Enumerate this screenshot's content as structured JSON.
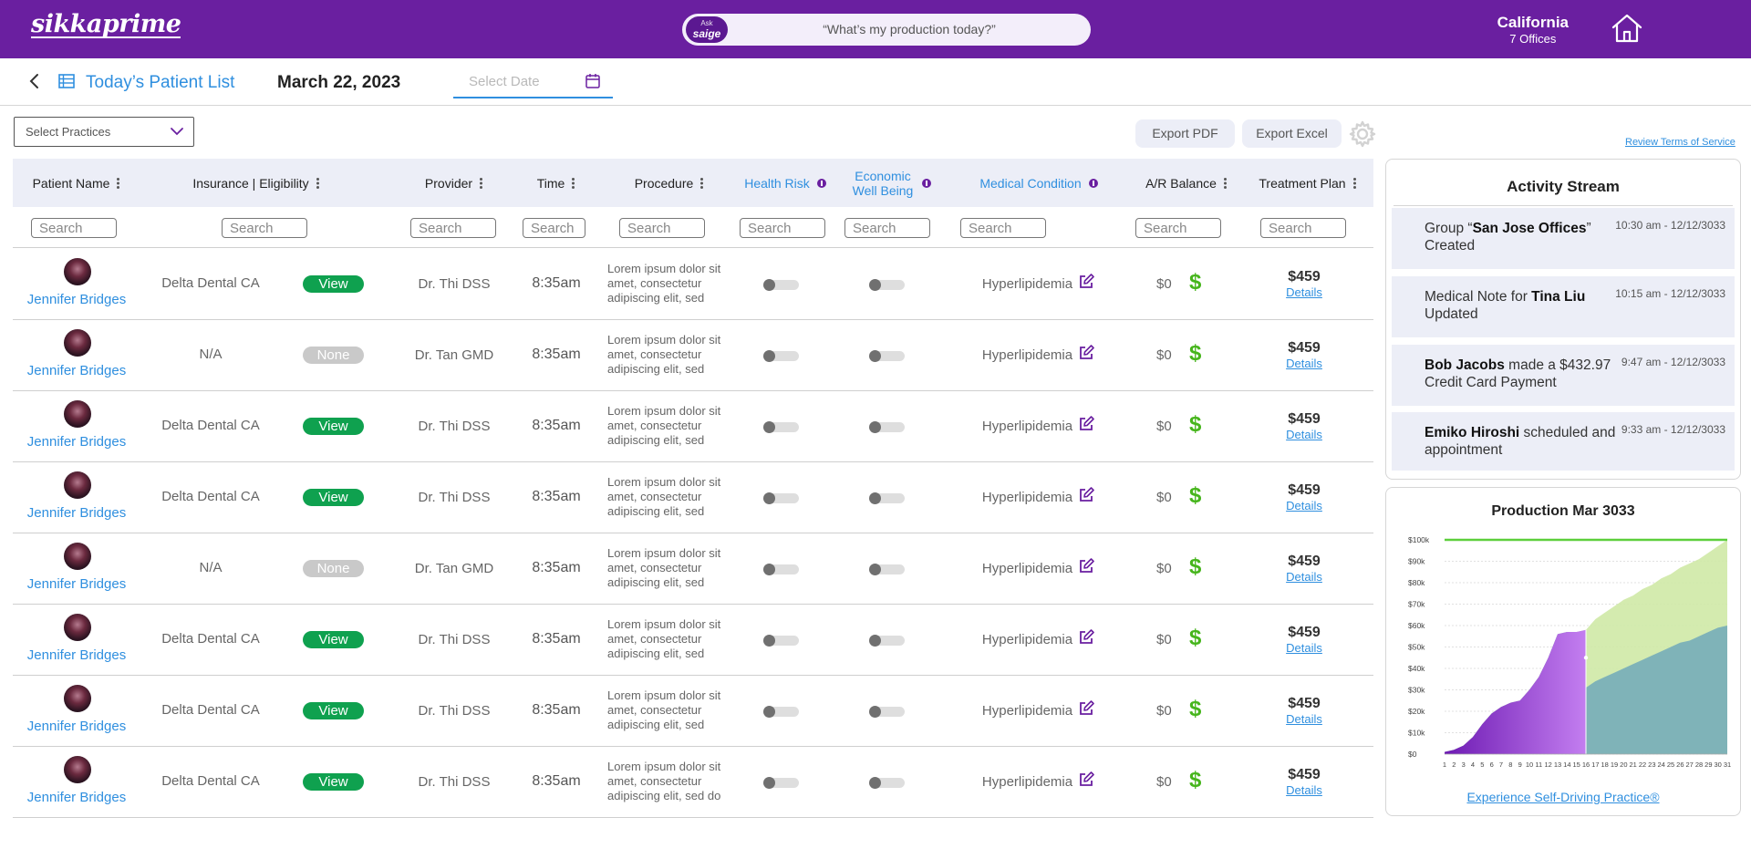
{
  "header": {
    "logo_text": "sikkaprime",
    "ask_badge_top": "Ask",
    "ask_badge_bottom": "saige",
    "ask_prompt": "“What’s my production today?”",
    "location_state": "California",
    "location_offices": "7 Offices"
  },
  "subheader": {
    "title": "Today’s Patient List",
    "date": "March 22, 2023",
    "date_placeholder": "Select Date"
  },
  "toolbar": {
    "practices_placeholder": "Select Practices",
    "export_pdf": "Export PDF",
    "export_excel": "Export Excel",
    "terms_link": "Review Terms of Service"
  },
  "table": {
    "columns": [
      {
        "label": "Patient Name",
        "menu": true,
        "info": false,
        "highlight": false
      },
      {
        "label": "Insurance | Eligibility",
        "menu": true,
        "info": false,
        "highlight": false
      },
      {
        "label": "Provider",
        "menu": true,
        "info": false,
        "highlight": false
      },
      {
        "label": "Time",
        "menu": true,
        "info": false,
        "highlight": false
      },
      {
        "label": "Procedure",
        "menu": true,
        "info": false,
        "highlight": false
      },
      {
        "label": "Health Risk",
        "menu": false,
        "info": true,
        "highlight": true
      },
      {
        "label": "Economic Well Being",
        "menu": false,
        "info": true,
        "highlight": true
      },
      {
        "label": "Medical Condition",
        "menu": false,
        "info": true,
        "highlight": true
      },
      {
        "label": "A/R Balance",
        "menu": true,
        "info": false,
        "highlight": false
      },
      {
        "label": "Treatment Plan",
        "menu": true,
        "info": false,
        "highlight": false
      }
    ],
    "search_placeholder": "Search",
    "rows": [
      {
        "name": "Jennifer Bridges",
        "insurance": "Delta Dental CA",
        "eligibility": "View",
        "provider": "Dr. Thi DSS",
        "time": "8:35am",
        "procedure": "Lorem ipsum dolor sit amet, consectetur adipiscing elit, sed",
        "condition": "Hyperlipidemia",
        "balance": "$0",
        "plan_amount": "$459",
        "plan_link": "Details"
      },
      {
        "name": "Jennifer Bridges",
        "insurance": "N/A",
        "eligibility": "None",
        "provider": "Dr. Tan GMD",
        "time": "8:35am",
        "procedure": "Lorem ipsum dolor sit amet, consectetur adipiscing elit, sed",
        "condition": "Hyperlipidemia",
        "balance": "$0",
        "plan_amount": "$459",
        "plan_link": "Details"
      },
      {
        "name": "Jennifer Bridges",
        "insurance": "Delta Dental CA",
        "eligibility": "View",
        "provider": "Dr. Thi DSS",
        "time": "8:35am",
        "procedure": "Lorem ipsum dolor sit amet, consectetur adipiscing elit, sed",
        "condition": "Hyperlipidemia",
        "balance": "$0",
        "plan_amount": "$459",
        "plan_link": "Details"
      },
      {
        "name": "Jennifer Bridges",
        "insurance": "Delta Dental CA",
        "eligibility": "View",
        "provider": "Dr. Thi DSS",
        "time": "8:35am",
        "procedure": "Lorem ipsum dolor sit amet, consectetur adipiscing elit, sed",
        "condition": "Hyperlipidemia",
        "balance": "$0",
        "plan_amount": "$459",
        "plan_link": "Details"
      },
      {
        "name": "Jennifer Bridges",
        "insurance": "N/A",
        "eligibility": "None",
        "provider": "Dr. Tan GMD",
        "time": "8:35am",
        "procedure": "Lorem ipsum dolor sit amet, consectetur adipiscing elit, sed",
        "condition": "Hyperlipidemia",
        "balance": "$0",
        "plan_amount": "$459",
        "plan_link": "Details"
      },
      {
        "name": "Jennifer Bridges",
        "insurance": "Delta Dental CA",
        "eligibility": "View",
        "provider": "Dr. Thi DSS",
        "time": "8:35am",
        "procedure": "Lorem ipsum dolor sit amet, consectetur adipiscing elit, sed",
        "condition": "Hyperlipidemia",
        "balance": "$0",
        "plan_amount": "$459",
        "plan_link": "Details"
      },
      {
        "name": "Jennifer Bridges",
        "insurance": "Delta Dental CA",
        "eligibility": "View",
        "provider": "Dr. Thi DSS",
        "time": "8:35am",
        "procedure": "Lorem ipsum dolor sit amet, consectetur adipiscing elit, sed",
        "condition": "Hyperlipidemia",
        "balance": "$0",
        "plan_amount": "$459",
        "plan_link": "Details"
      },
      {
        "name": "Jennifer Bridges",
        "insurance": "Delta Dental CA",
        "eligibility": "View",
        "provider": "Dr. Thi DSS",
        "time": "8:35am",
        "procedure": "Lorem ipsum dolor sit amet, consectetur adipiscing elit, sed do",
        "condition": "Hyperlipidemia",
        "balance": "$0",
        "plan_amount": "$459",
        "plan_link": "Details"
      }
    ]
  },
  "activity": {
    "title": "Activity Stream",
    "items": [
      {
        "pre": "Group “",
        "bold": "San Jose Offices",
        "post": "” Created",
        "time": "10:30 am - 12/12/3033"
      },
      {
        "pre": "Medical Note for ",
        "bold": "Tina Liu",
        "post": " Updated",
        "time": "10:15 am - 12/12/3033"
      },
      {
        "pre": "",
        "bold": "Bob Jacobs",
        "post": " made a $432.97 Credit Card Payment",
        "time": "9:47 am - 12/12/3033"
      },
      {
        "pre": "",
        "bold": "Emiko Hiroshi",
        "post": " scheduled and appointment",
        "time": "9:33 am - 12/12/3033"
      }
    ]
  },
  "production": {
    "title": "Production Mar 3033",
    "cta": "Experience Self-Driving Practice®"
  },
  "chart_data": {
    "type": "area",
    "title": "Production Mar 3033",
    "x": [
      1,
      2,
      3,
      4,
      5,
      6,
      7,
      8,
      9,
      10,
      11,
      12,
      13,
      14,
      15,
      16,
      17,
      18,
      19,
      20,
      21,
      22,
      23,
      24,
      25,
      26,
      27,
      28,
      29,
      30,
      31
    ],
    "x_tick_labels": [
      "1",
      "2",
      "3",
      "4",
      "5",
      "6",
      "7",
      "8",
      "9",
      "10",
      "11",
      "12",
      "13",
      "14",
      "15",
      "16",
      "17",
      "18",
      "19",
      "20",
      "21",
      "22",
      "23",
      "24",
      "25",
      "26",
      "27",
      "28",
      "29",
      "30",
      "31"
    ],
    "y_tick_labels": [
      "$0",
      "$10k",
      "$20k",
      "$30k",
      "$40k",
      "$50k",
      "$60k",
      "$70k",
      "$80k",
      "$90k",
      "$100k"
    ],
    "ylim": [
      0,
      100000
    ],
    "goal_value": 100000,
    "current_day": 16,
    "series": [
      {
        "role": "actual",
        "color": "#8a3fd0",
        "values": [
          1000,
          2000,
          4000,
          8000,
          14000,
          19000,
          22000,
          24000,
          25000,
          30000,
          36000,
          45000,
          56000,
          57000,
          57000,
          58000,
          null,
          null,
          null,
          null,
          null,
          null,
          null,
          null,
          null,
          null,
          null,
          null,
          null,
          null,
          null
        ]
      },
      {
        "role": "upper",
        "color": "#cfe9a6",
        "values": [
          1000,
          2000,
          4000,
          8000,
          14000,
          19000,
          22000,
          24000,
          25000,
          30000,
          36000,
          45000,
          56000,
          57000,
          57000,
          58000,
          63000,
          66000,
          69000,
          72000,
          74000,
          77000,
          79000,
          82000,
          84000,
          87000,
          89000,
          91000,
          94000,
          97000,
          100000
        ]
      },
      {
        "role": "lower",
        "color": "#7fb3b8",
        "values": [
          1000,
          2000,
          4000,
          8000,
          14000,
          19000,
          22000,
          24000,
          25000,
          30000,
          36000,
          45000,
          56000,
          57000,
          57000,
          31000,
          34000,
          36000,
          38000,
          40000,
          42000,
          44000,
          46000,
          48000,
          50000,
          52000,
          53000,
          55000,
          57000,
          59000,
          60000
        ]
      }
    ],
    "grid": true
  }
}
